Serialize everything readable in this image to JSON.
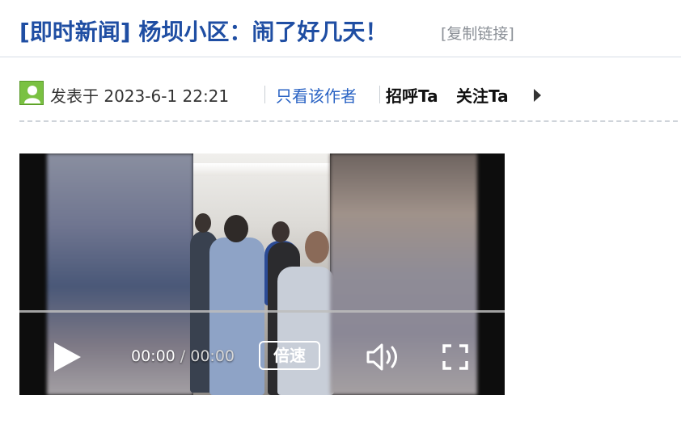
{
  "header": {
    "title": "[即时新闻] 杨坝小区：闹了好几天！",
    "copy_link": "[复制链接]"
  },
  "post_meta": {
    "posted_at": "发表于 2023-6-1 22:21",
    "only_author": "只看该作者",
    "greet": "招呼Ta",
    "follow": "关注Ta"
  },
  "video": {
    "current_time": "00:00",
    "separator": " / ",
    "duration": "00:00",
    "speed_label": "倍速",
    "progress": 0
  },
  "icons": {
    "avatar": "default-avatar-icon",
    "more": "triangle-right-icon",
    "play": "play-icon",
    "volume": "volume-icon",
    "fullscreen": "fullscreen-icon"
  }
}
